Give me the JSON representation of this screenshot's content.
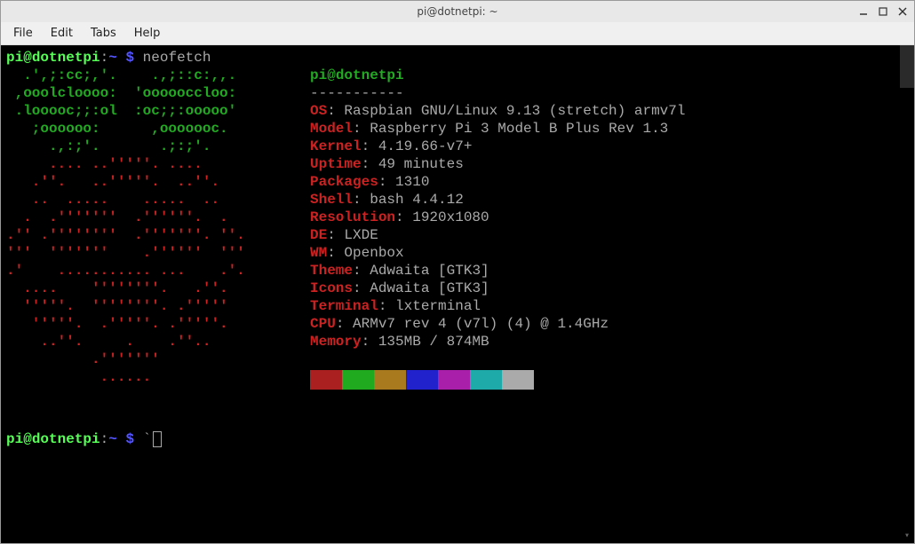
{
  "window": {
    "title": "pi@dotnetpi: ~"
  },
  "menubar": {
    "items": [
      "File",
      "Edit",
      "Tabs",
      "Help"
    ]
  },
  "prompt": {
    "user": "pi",
    "at": "@",
    "host": "dotnetpi",
    "sep": ":",
    "path": "~",
    "dollar": " $ ",
    "command": "neofetch"
  },
  "ascii": {
    "green": [
      "  .',;:cc;,'.    .,;::c:,,.   ",
      " ,ooolcloooo:  'oooooccloo:   ",
      " .looooc;;:ol  :oc;;:ooooo'   ",
      "   ;oooooo:      ,ooooooc.    ",
      "     .,:;'.       .;:;'.      "
    ],
    "red": [
      "     .... ..'''''. ....       ",
      "   .''.   ..'''''.  ..''.     ",
      "   ..  .....    .....  ..     ",
      "  .  .'''''''  .''''''.  .    ",
      ".'' .''''''''  .'''''''. ''.  ",
      "'''  '''''''    .''''''  '''  ",
      ".'    ........... ...    .'.  ",
      "  ....    ''''''''.   .''.    ",
      "  '''''.  ''''''''. .'''''    ",
      "   '''''.  .'''''. .'''''.    ",
      "    ..''.     .    .''..      ",
      "          .'''''''            ",
      "           ......             "
    ]
  },
  "neofetch": {
    "title_user": "pi",
    "title_at": "@",
    "title_host": "dotnetpi",
    "dashes": "-----------",
    "rows": [
      {
        "label": "OS",
        "value": "Raspbian GNU/Linux 9.13 (stretch) armv7l"
      },
      {
        "label": "Model",
        "value": "Raspberry Pi 3 Model B Plus Rev 1.3"
      },
      {
        "label": "Kernel",
        "value": "4.19.66-v7+"
      },
      {
        "label": "Uptime",
        "value": "49 minutes"
      },
      {
        "label": "Packages",
        "value": "1310"
      },
      {
        "label": "Shell",
        "value": "bash 4.4.12"
      },
      {
        "label": "Resolution",
        "value": "1920x1080"
      },
      {
        "label": "DE",
        "value": "LXDE"
      },
      {
        "label": "WM",
        "value": "Openbox"
      },
      {
        "label": "Theme",
        "value": "Adwaita [GTK3]"
      },
      {
        "label": "Icons",
        "value": "Adwaita [GTK3]"
      },
      {
        "label": "Terminal",
        "value": "lxterminal"
      },
      {
        "label": "CPU",
        "value": "ARMv7 rev 4 (v7l) (4) @ 1.4GHz"
      },
      {
        "label": "Memory",
        "value": "135MB / 874MB"
      }
    ],
    "swatches": [
      "#aa1f1f",
      "#1faa1f",
      "#aa7a1f",
      "#2222cc",
      "#aa1faa",
      "#1faaaa",
      "#aaaaaa"
    ]
  },
  "prompt2": {
    "user": "pi",
    "at": "@",
    "host": "dotnetpi",
    "sep": ":",
    "path": "~",
    "dollar": " $ ",
    "tick": "`"
  }
}
